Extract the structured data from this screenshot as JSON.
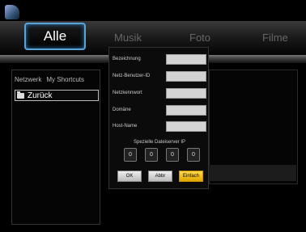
{
  "tabs": [
    {
      "label": "Alle",
      "active": true
    },
    {
      "label": "Musik"
    },
    {
      "label": "Foto"
    },
    {
      "label": "Filme"
    }
  ],
  "left_nav": {
    "network": "Netzwerk",
    "shortcuts": "My Shortcuts",
    "back": "Zurück"
  },
  "dialog": {
    "fields": [
      {
        "label": "Bezeichnung",
        "value": ""
      },
      {
        "label": "Netz-Benutzer-ID",
        "value": ""
      },
      {
        "label": "Netzkennwort",
        "value": ""
      },
      {
        "label": "Domäne",
        "value": ""
      },
      {
        "label": "Host-Name",
        "value": ""
      }
    ],
    "ip_title": "Spezielle Dateiserver IP",
    "ip": [
      "0",
      "0",
      "0",
      "0"
    ],
    "buttons": {
      "ok": "OK",
      "cancel": "Abbr",
      "simple": "Einfach"
    }
  },
  "colors": {
    "accent": "#5aa5d8",
    "highlight_button": "#f2c21b"
  }
}
